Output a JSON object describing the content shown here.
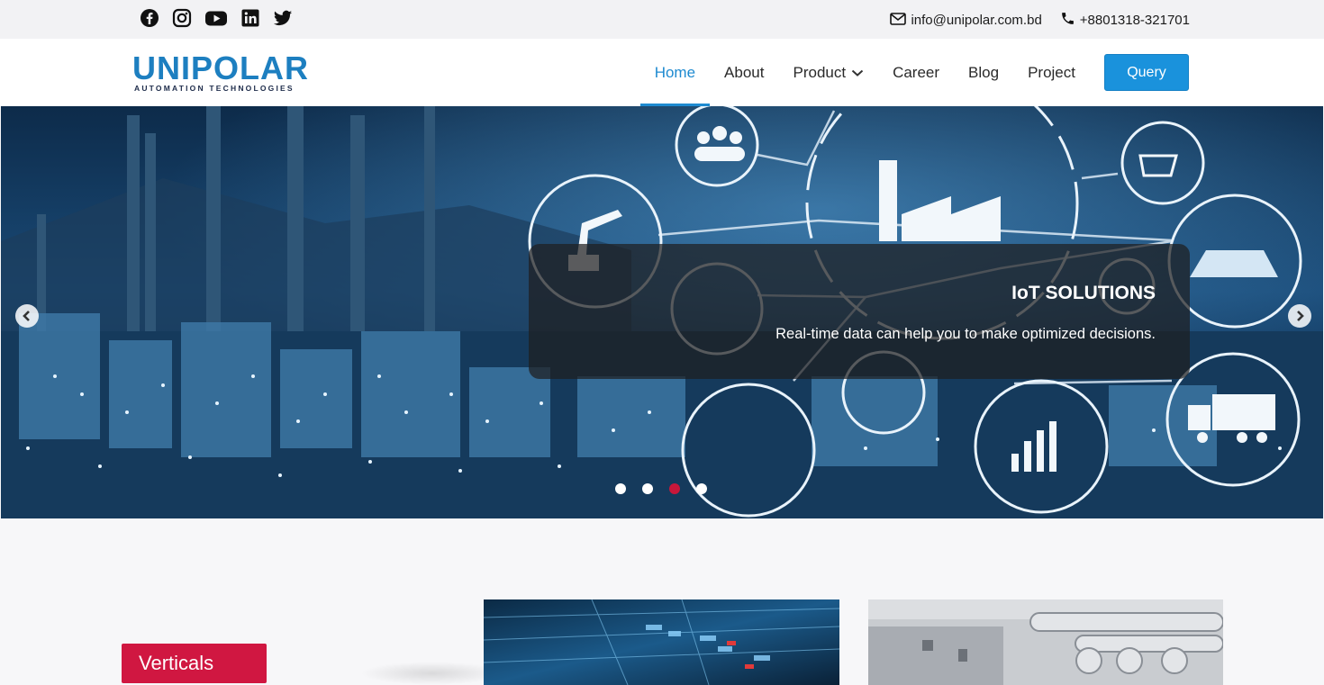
{
  "topbar": {
    "social_icons": [
      "facebook-icon",
      "instagram-icon",
      "youtube-icon",
      "linkedin-icon",
      "twitter-icon"
    ],
    "email": "info@unipolar.com.bd",
    "phone": "+8801318-321701"
  },
  "logo": {
    "name": "UNIPOLAR",
    "tagline": "AUTOMATION TECHNOLOGIES"
  },
  "nav": {
    "items": [
      {
        "label": "Home",
        "active": true
      },
      {
        "label": "About"
      },
      {
        "label": "Product",
        "has_dropdown": true
      },
      {
        "label": "Career"
      },
      {
        "label": "Blog"
      },
      {
        "label": "Project"
      }
    ],
    "cta": "Query"
  },
  "hero": {
    "title": "IoT SOLUTIONS",
    "description": "Real-time data can help you to make optimized decisions.",
    "slide_count": 4,
    "active_slide": 3
  },
  "section": {
    "verticals_label": "Verticals"
  },
  "colors": {
    "accent": "#1e8ad0",
    "cta": "#1a92dc",
    "verticals": "#d01741",
    "active_dot": "#c8173a"
  }
}
